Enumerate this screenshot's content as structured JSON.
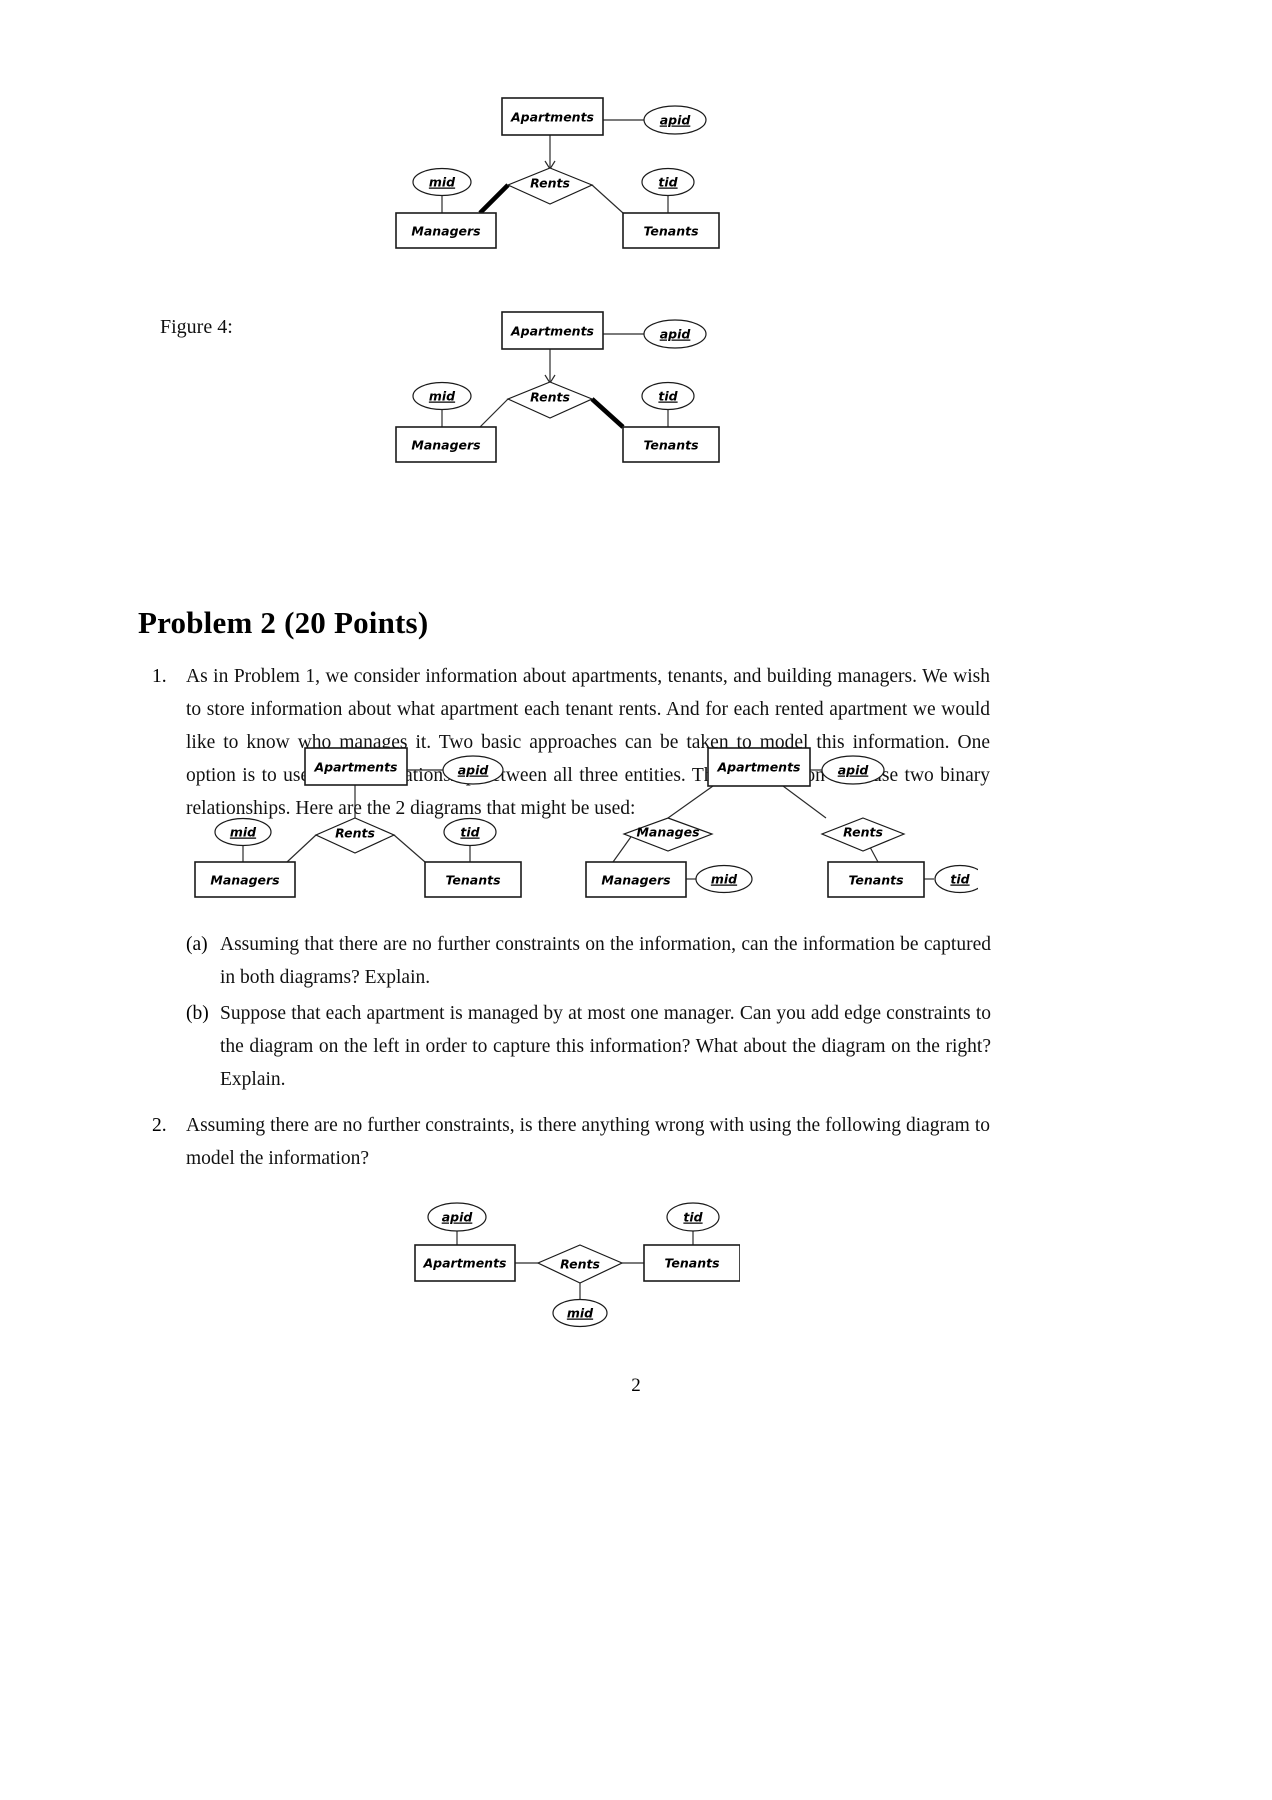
{
  "document": {
    "page_number": "2",
    "figure_caption": "Figure 4:",
    "section_title": "Problem 2 (20 Points)",
    "items": [
      {
        "marker": "1.",
        "text": "As in Problem 1, we consider information about apartments, tenants, and building managers. We wish to store information about what apartment each tenant rents. And for each rented apartment we would like to know who manages it. Two basic approaches can be taken to model this information. One option is to use a single relationship between all three entities. The other option is to use two binary relationships. Here are the 2 diagrams that might be used:"
      },
      {
        "marker": "(a)",
        "text": "Assuming that there are no further constraints on the information, can the information be captured in both diagrams? Explain."
      },
      {
        "marker": "(b)",
        "text": "Suppose that each apartment is managed by at most one manager. Can you add edge constraints to the diagram on the left in order to capture this information? What about the diagram on the right? Explain."
      },
      {
        "marker": "2.",
        "text": "Assuming there are no further constraints, is there anything wrong with using the following diagram to model the information?"
      }
    ]
  },
  "diagrams": {
    "top": {
      "name": "ternary-rents-bold-managers",
      "entities": {
        "apartments": "Apartments",
        "managers": "Managers",
        "tenants": "Tenants"
      },
      "relationship": "Rents",
      "attributes": {
        "apid": "apid",
        "mid": "mid",
        "tid": "tid"
      },
      "edges": {
        "apartments_to_rents": "arrow",
        "rents_to_managers": "bold",
        "rents_to_tenants": "plain"
      }
    },
    "figure4": {
      "name": "ternary-rents-bold-tenants",
      "entities": {
        "apartments": "Apartments",
        "managers": "Managers",
        "tenants": "Tenants"
      },
      "relationship": "Rents",
      "attributes": {
        "apid": "apid",
        "mid": "mid",
        "tid": "tid"
      },
      "edges": {
        "apartments_to_rents": "arrow",
        "rents_to_managers": "plain",
        "rents_to_tenants": "bold"
      }
    },
    "pair_left": {
      "name": "ternary-rents-plain",
      "entities": {
        "apartments": "Apartments",
        "managers": "Managers",
        "tenants": "Tenants"
      },
      "relationship": "Rents",
      "attributes": {
        "apid": "apid",
        "mid": "mid",
        "tid": "tid"
      },
      "edges": {
        "apartments_to_rents": "plain",
        "rents_to_managers": "plain",
        "rents_to_tenants": "plain"
      }
    },
    "pair_right": {
      "name": "two-binary-relationships",
      "entities": {
        "apartments": "Apartments",
        "managers": "Managers",
        "tenants": "Tenants"
      },
      "relationships": {
        "manages": "Manages",
        "rents": "Rents"
      },
      "attributes": {
        "apid": "apid",
        "mid": "mid",
        "tid": "tid"
      }
    },
    "bottom": {
      "name": "binary-rents-with-mid-attribute",
      "entities": {
        "apartments": "Apartments",
        "tenants": "Tenants"
      },
      "relationship": "Rents",
      "attributes": {
        "apid": "apid",
        "tid": "tid",
        "mid": "mid"
      }
    }
  },
  "colors": {
    "ink": "#000000",
    "line": "#2b2b2b",
    "paper": "#ffffff"
  }
}
